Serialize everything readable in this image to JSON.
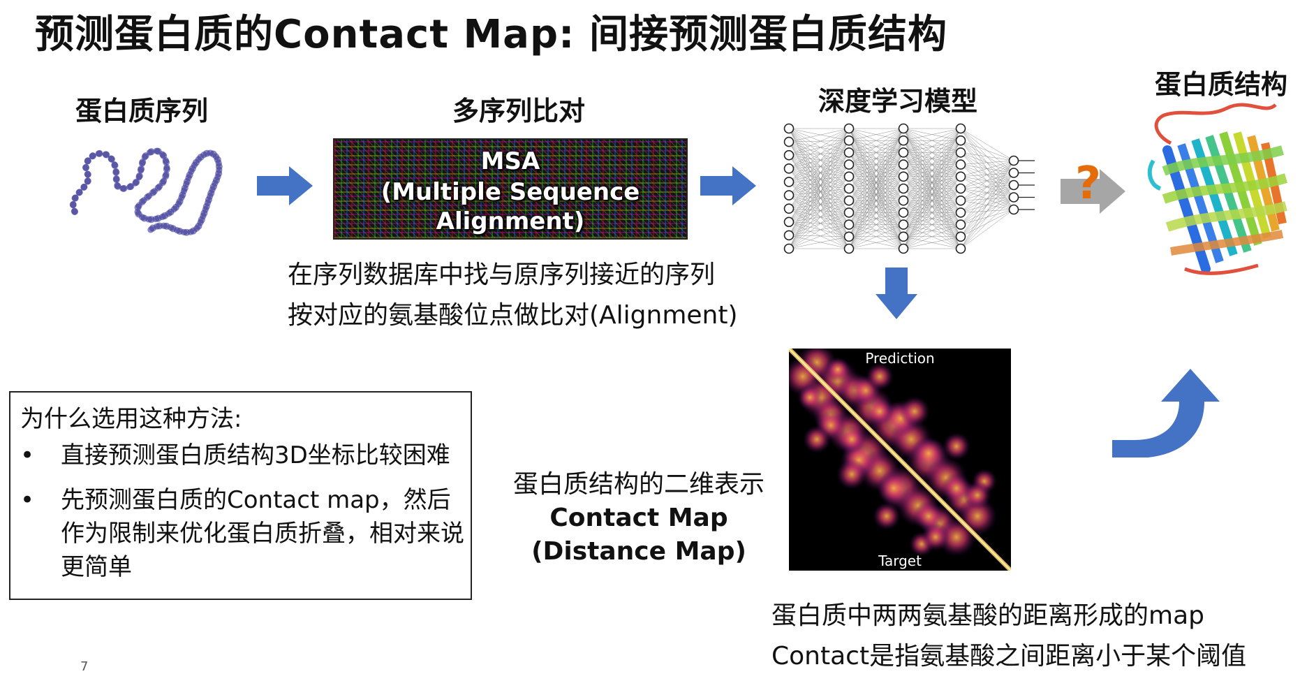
{
  "slide": {
    "title": "预测蛋白质的Contact Map: 间接预测蛋白质结构",
    "page_number": "7"
  },
  "pipeline": {
    "step1_label": "蛋白质序列",
    "step2_label": "多序列比对",
    "step3_label": "深度学习模型",
    "step4_label": "蛋白质结构",
    "msa_line1": "MSA",
    "msa_line2": "(Multiple Sequence",
    "msa_line3": "Alignment)",
    "msa_note_line1": "在序列数据库中找与原序列接近的序列",
    "msa_note_line2": "按对应的氨基酸位点做比对(Alignment)",
    "unknown_symbol": "?"
  },
  "contact_map": {
    "top_label": "Prediction",
    "bottom_label": "Target",
    "caption_line1": "蛋白质结构的二维表示",
    "caption_line2": "Contact Map",
    "caption_line3": "(Distance Map)",
    "note_line1": "蛋白质中两两氨基酸的距离形成的map",
    "note_line2": "Contact是指氨基酸之间距离小于某个阈值"
  },
  "reason_box": {
    "heading": "为什么选用这种方法:",
    "bullet_symbol": "•",
    "bullets": [
      "直接预测蛋白质结构3D坐标比较困难",
      "先预测蛋白质的Contact map，然后作为限制来优化蛋白质折叠，相对来说更简单"
    ]
  },
  "colors": {
    "arrow_blue": "#4472c4",
    "arrow_gray": "#a6a6a6",
    "question_orange": "#e46c0a"
  },
  "icons": {
    "protein_chain": "bead-chain-icon",
    "neural_network": "neural-network-icon",
    "protein_structure": "beta-barrel-icon"
  }
}
